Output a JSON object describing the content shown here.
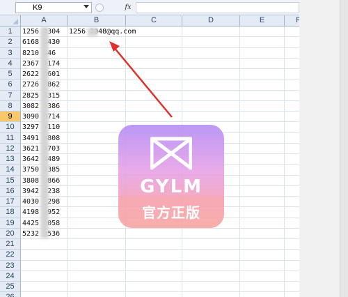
{
  "formula_bar": {
    "name_box": "K9",
    "fx_label": "fx",
    "formula_value": ""
  },
  "columns": [
    "A",
    "B",
    "C",
    "D",
    "E",
    "F"
  ],
  "rows": [
    "1",
    "2",
    "3",
    "4",
    "5",
    "6",
    "7",
    "8",
    "9",
    "10",
    "11",
    "12",
    "13",
    "14",
    "15",
    "16",
    "17",
    "18",
    "19",
    "20",
    "21",
    "22",
    "23",
    "24",
    "25",
    "26"
  ],
  "active_row": "9",
  "column_a_values": [
    "1256   3304",
    "6168   5430",
    "8210   546",
    "2367   4174",
    "2622   3601",
    "2726   0862",
    "2825   3315",
    "3082   5386",
    "3090   0714",
    "3297   3110",
    "3491   3808",
    "3621   9703",
    "3642   9489",
    "3750   0385",
    "3808   9866",
    "3942   7238",
    "4030   1298",
    "4198   0952",
    "4425   2058",
    "5232   3536"
  ],
  "b1_value": "1256   3048@qq.com",
  "watermark": {
    "brand": "GYLM",
    "subtitle": "官方正版",
    "icon": "bowtie-envelope-icon",
    "colors": {
      "top": "#b38af5",
      "bottom": "#f5b08e"
    }
  },
  "annotation": {
    "icon": "red-arrow-icon",
    "color": "#e0302a"
  }
}
